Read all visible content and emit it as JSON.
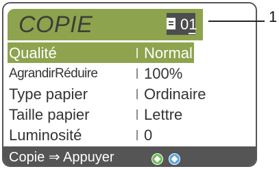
{
  "screen": {
    "title": "COPIE",
    "copies_icon": "document-icon",
    "copies_count": "01"
  },
  "menu": {
    "items": [
      {
        "label": "Qualité",
        "value": "Normal",
        "selected": true
      },
      {
        "label": "AgrandirRéduire",
        "value": "100%"
      },
      {
        "label": "Type papier",
        "value": "Ordinaire"
      },
      {
        "label": "Taille papier",
        "value": "Lettre"
      },
      {
        "label": "Luminosité",
        "value": "0"
      }
    ]
  },
  "status": {
    "text": "Copie ⇒ Appuyer",
    "keys": [
      "start-mono-icon",
      "start-colour-icon"
    ]
  },
  "callout": {
    "number": "1"
  },
  "colors": {
    "highlight": "#8da34e",
    "bar": "#555555",
    "mono_key": "#6fbf57",
    "colour_key": "#5aa9e6"
  }
}
